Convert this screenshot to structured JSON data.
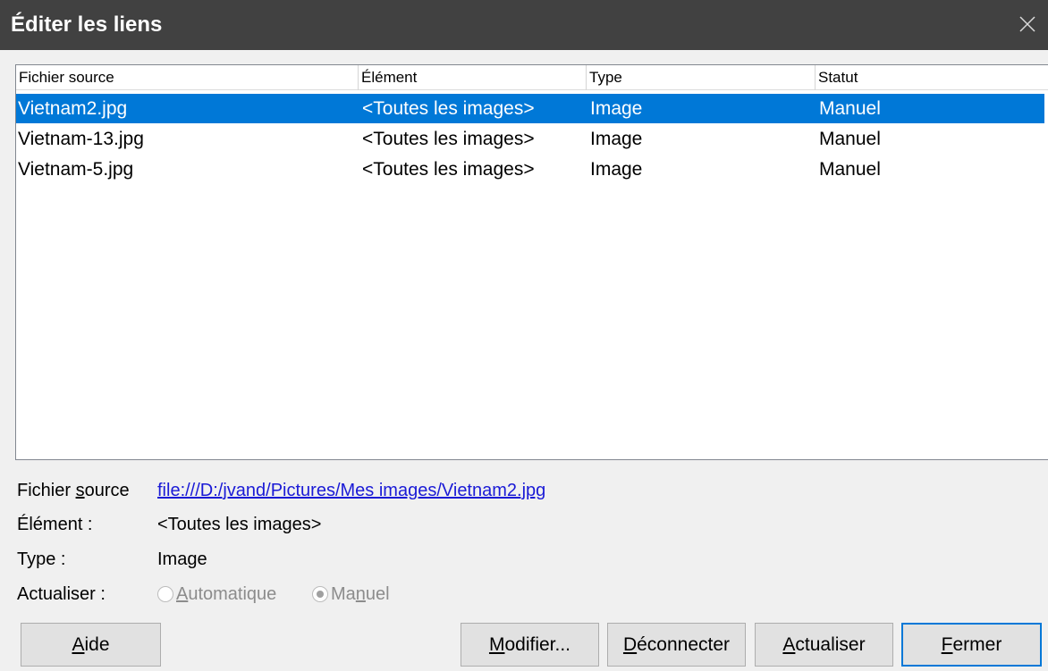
{
  "window": {
    "title": "Éditer les liens"
  },
  "list": {
    "columns": [
      "Fichier source",
      "Élément",
      "Type",
      "Statut"
    ],
    "rows": [
      {
        "source": "Vietnam2.jpg",
        "element": "<Toutes les images>",
        "type": "Image",
        "status": "Manuel",
        "selected": true
      },
      {
        "source": "Vietnam-13.jpg",
        "element": "<Toutes les images>",
        "type": "Image",
        "status": "Manuel",
        "selected": false
      },
      {
        "source": "Vietnam-5.jpg",
        "element": "<Toutes les images>",
        "type": "Image",
        "status": "Manuel",
        "selected": false
      }
    ]
  },
  "details": {
    "source_label_pre": "Fichier ",
    "source_label_u": "s",
    "source_label_post": "ource",
    "source_value": "file:///D:/jvand/Pictures/Mes images/Vietnam2.jpg",
    "element_label": "Élément :",
    "element_value": "<Toutes les images>",
    "type_label": "Type :",
    "type_value": "Image",
    "update_label": "Actualiser :",
    "auto_u": "A",
    "auto_rest": "utomatique",
    "manual_pre": "Ma",
    "manual_u": "n",
    "manual_post": "uel",
    "update_mode": "Manuel"
  },
  "buttons": {
    "help_u": "A",
    "help_rest": "ide",
    "modify_u": "M",
    "modify_rest": "odifier...",
    "disconnect_u": "D",
    "disconnect_rest": "éconnecter",
    "update_u": "A",
    "update_rest": "ctualiser",
    "close_u": "F",
    "close_rest": "ermer"
  },
  "colors": {
    "selection": "#0078d7",
    "titlebar": "#414141",
    "link": "#1a1ad6"
  },
  "icons": {
    "close": "close-icon"
  }
}
